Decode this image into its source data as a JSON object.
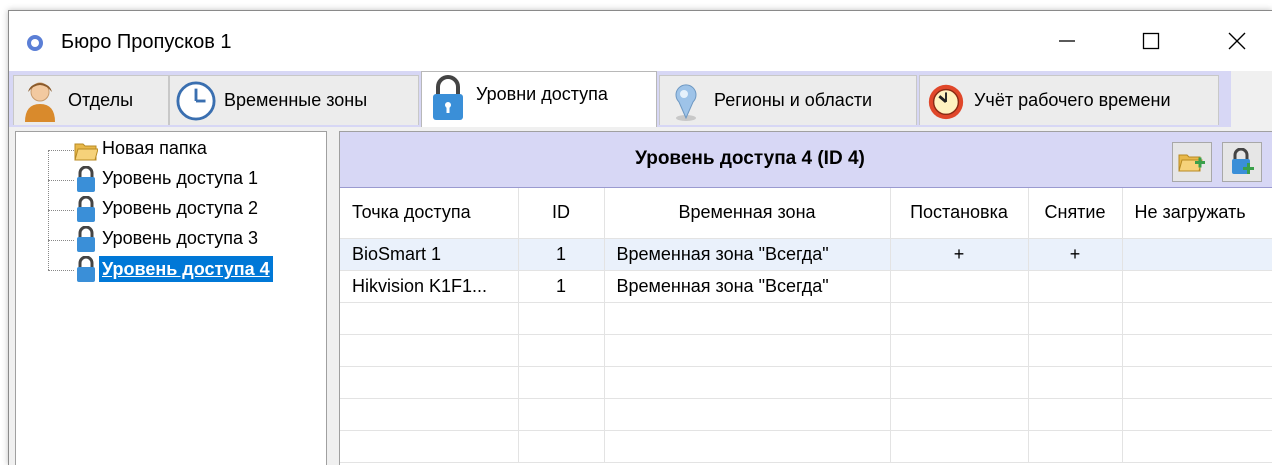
{
  "window": {
    "title": "Бюро Пропусков 1",
    "controls": {
      "minimize": "—",
      "maximize": "☐",
      "close": "✕"
    }
  },
  "tabs": [
    {
      "label": "Отделы",
      "icon": "person-icon"
    },
    {
      "label": "Временные зоны",
      "icon": "clock-icon"
    },
    {
      "label": "Уровни доступа",
      "icon": "padlock-icon",
      "active": true
    },
    {
      "label": "Регионы и области",
      "icon": "map-pin-icon"
    },
    {
      "label": "Учёт рабочего времени",
      "icon": "alarm-clock-icon"
    }
  ],
  "tree": {
    "items": [
      {
        "label": "Новая папка",
        "icon": "folder-icon"
      },
      {
        "label": "Уровень доступа 1",
        "icon": "padlock-icon"
      },
      {
        "label": "Уровень доступа 2",
        "icon": "padlock-icon"
      },
      {
        "label": "Уровень доступа 3",
        "icon": "padlock-icon"
      },
      {
        "label": "Уровень доступа 4",
        "icon": "padlock-icon",
        "selected": true
      }
    ]
  },
  "panel": {
    "title": "Уровень доступа 4 (ID 4)",
    "buttons": {
      "add_folder": "add-folder-icon",
      "add_access_level": "add-access-level-icon"
    }
  },
  "grid": {
    "columns": [
      "Точка доступа",
      "ID",
      "Временная зона",
      "Постановка",
      "Снятие",
      "Не загружать"
    ],
    "rows": [
      [
        "BioSmart 1",
        "1",
        "Временная зона \"Всегда\"",
        "+",
        "+",
        ""
      ],
      [
        "Hikvision K1F1...",
        "1",
        "Временная зона \"Всегда\"",
        "",
        "",
        ""
      ]
    ]
  },
  "colors": {
    "accent_header": "#d7d7f5",
    "selection": "#0078d7"
  }
}
